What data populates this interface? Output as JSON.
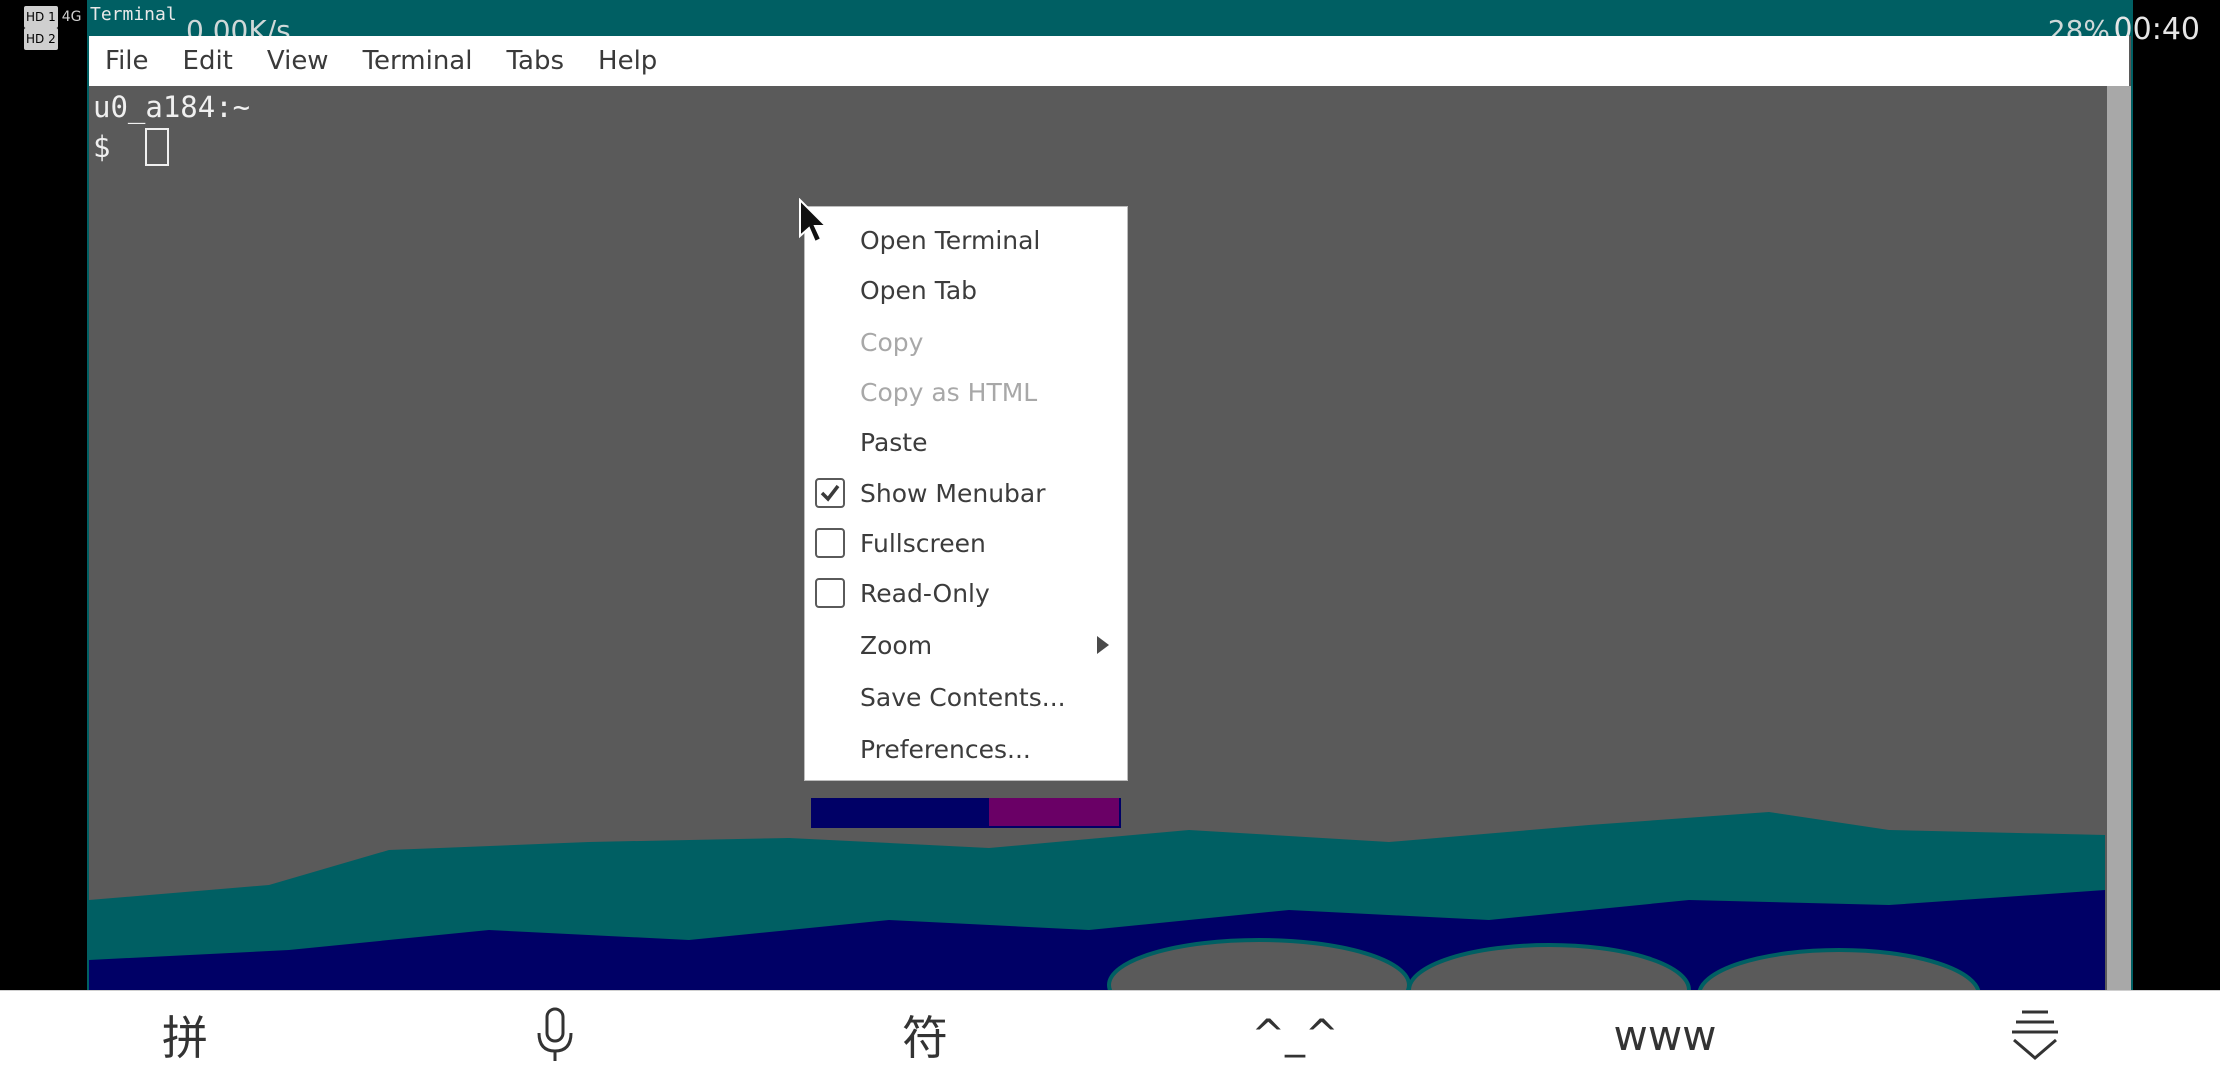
{
  "status_bar": {
    "left_badges": [
      "HD 1",
      "4G",
      "HD 2"
    ],
    "speed": "0.00K/s",
    "battery": "28%",
    "time": "00:40"
  },
  "window": {
    "title": "Terminal"
  },
  "menubar": {
    "items": [
      "File",
      "Edit",
      "View",
      "Terminal",
      "Tabs",
      "Help"
    ]
  },
  "terminal": {
    "line1": "u0_a184:~",
    "prompt": "$"
  },
  "context_menu": {
    "items": [
      {
        "label": "Open Terminal",
        "enabled": true
      },
      {
        "label": "Open Tab",
        "enabled": true
      },
      {
        "label": "Copy",
        "enabled": false
      },
      {
        "label": "Copy as HTML",
        "enabled": false
      },
      {
        "label": "Paste",
        "enabled": true
      },
      {
        "label": "Show Menubar",
        "enabled": true,
        "checkbox": true,
        "checked": true
      },
      {
        "label": "Fullscreen",
        "enabled": true,
        "checkbox": true,
        "checked": false
      },
      {
        "label": "Read-Only",
        "enabled": true,
        "checkbox": true,
        "checked": false
      },
      {
        "label": "Zoom",
        "enabled": true,
        "submenu": true
      },
      {
        "label": "Save Contents...",
        "enabled": true
      },
      {
        "label": "Preferences...",
        "enabled": true
      }
    ]
  },
  "ime_toolbar": {
    "keys": [
      {
        "label": "拼",
        "icon": "pinyin-icon"
      },
      {
        "label": "",
        "icon": "microphone-icon"
      },
      {
        "label": "符",
        "icon": "symbol-icon"
      },
      {
        "label": "^_^",
        "icon": "emoticon-icon"
      },
      {
        "label": "www",
        "icon": "www-icon"
      },
      {
        "label": "",
        "icon": "hide-keyboard-icon"
      }
    ]
  },
  "colors": {
    "terminal_bg": "#5a5a5a",
    "desktop_teal": "#005f63",
    "navy": "#000066",
    "menu_text": "#3c3c3c",
    "disabled_text": "#a8a8a8"
  }
}
